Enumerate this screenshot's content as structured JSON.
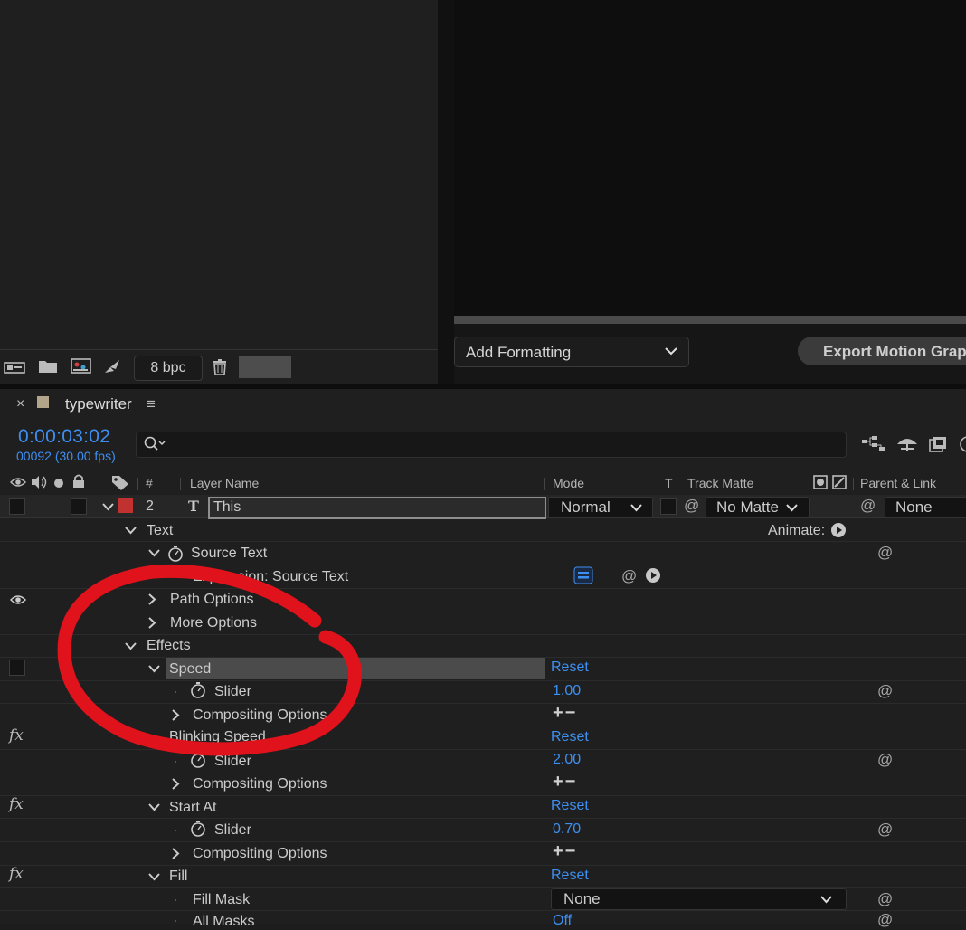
{
  "project_panel": {
    "bpc_label": "8 bpc"
  },
  "essential_graphics": {
    "add_formatting_label": "Add Formatting",
    "export_button_label": "Export Motion Graph"
  },
  "timeline": {
    "comp_name": "typewriter",
    "timecode": "0:00:03:02",
    "frames_fps": "00092 (30.00 fps)",
    "search_placeholder": "",
    "headers": {
      "number": "#",
      "layer_name": "Layer Name",
      "mode": "Mode",
      "t": "T",
      "track_matte": "Track Matte",
      "parent_link": "Parent & Link"
    },
    "layer": {
      "number": "2",
      "type_icon": "T",
      "name": "This",
      "mode": "Normal",
      "track_matte": "No Matte",
      "parent": "None"
    },
    "animate_label": "Animate:",
    "properties": {
      "text": "Text",
      "source_text": "Source Text",
      "expression_source_text": "Expression: Source Text",
      "path_options": "Path Options",
      "more_options": "More Options",
      "effects": "Effects",
      "speed": "Speed",
      "speed_slider_label": "Slider",
      "speed_slider_value": "1.00",
      "compositing_options_1": "Compositing Options",
      "blinking_speed": "Blinking Speed",
      "blinking_slider_label": "Slider",
      "blinking_slider_value": "2.00",
      "compositing_options_2": "Compositing Options",
      "start_at": "Start At",
      "start_slider_label": "Slider",
      "start_slider_value": "0.70",
      "compositing_options_3": "Compositing Options",
      "fill": "Fill",
      "fill_mask_label": "Fill Mask",
      "fill_mask_value": "None",
      "all_masks_label": "All Masks",
      "all_masks_value": "Off"
    },
    "reset_label": "Reset",
    "fx_label": "fx",
    "plus_minus": "+−"
  },
  "colors": {
    "accent_blue": "#3d8ff0",
    "annotation_red": "#e0121b",
    "layer_label": "#c0312f",
    "comp_swatch": "#b3a58a"
  }
}
